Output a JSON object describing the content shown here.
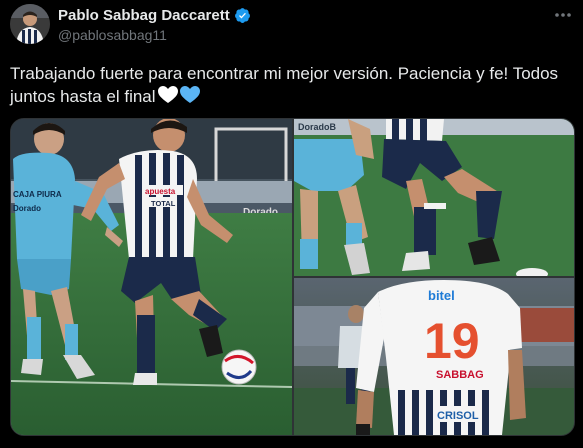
{
  "author": {
    "display_name": "Pablo Sabbag Daccarett",
    "handle": "@pablosabbag11",
    "verified": true,
    "avatar_icon": "player-avatar"
  },
  "tweet": {
    "text_line1": "Trabajando fuerte para encontrar mi mejor versión. Paciencia y fe! Todos",
    "text_line2": "juntos hasta el final",
    "emojis": [
      "white-heart",
      "light-blue-heart"
    ]
  },
  "media": {
    "photo_count": 3,
    "photo1": {
      "sponsors_left": [
        "CAJA PIURA",
        "Dorado"
      ],
      "sponsors_right": [
        "apuesta",
        "TOTAL"
      ],
      "number": "",
      "board_text": "Dorado"
    },
    "photo2": {
      "board_text": "DoradoB"
    },
    "photo3": {
      "sponsor_top": "bitel",
      "number": "19",
      "player_name": "SABBAG",
      "sponsor_bottom": "CRISOL"
    }
  },
  "colors": {
    "background": "#000000",
    "text": "#e7e9ea",
    "secondary": "#71767b",
    "verified": "#1d9bf0",
    "cristal_sky": "#5ab3d9",
    "alianza_navy": "#1b2a4a",
    "pitch_green": "#2f6b35"
  }
}
